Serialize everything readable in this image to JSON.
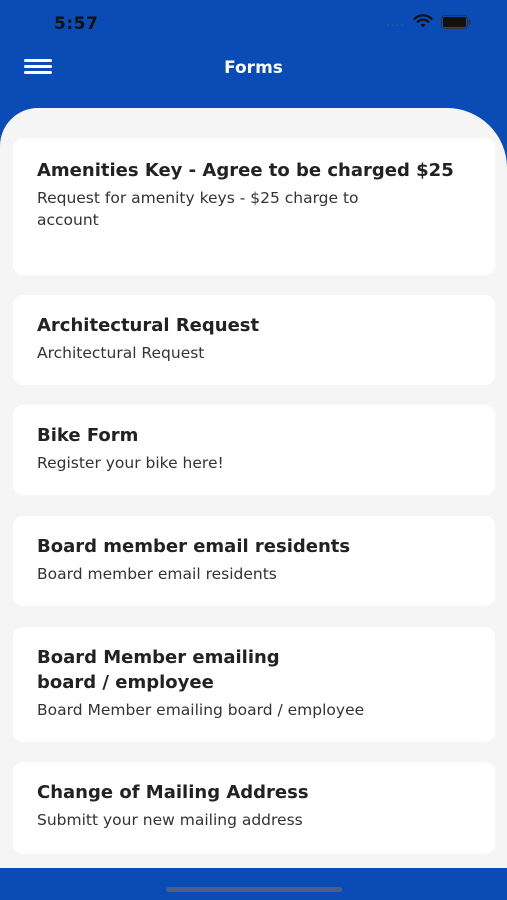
{
  "status": {
    "time": "5:57",
    "signal": "....",
    "wifi_icon": "wifi-icon",
    "battery_icon": "battery-icon"
  },
  "header": {
    "title": "Forms",
    "menu_icon": "hamburger-menu-icon"
  },
  "forms": [
    {
      "title": "Amenities Key - Agree to be charged $25",
      "description": "Request for amenity keys - $25 charge to account"
    },
    {
      "title": "Architectural Request",
      "description": "Architectural Request"
    },
    {
      "title": "Bike Form",
      "description": "Register your bike here!"
    },
    {
      "title": "Board member email residents",
      "description": "Board member email residents"
    },
    {
      "title": "Board Member emailing board / employee",
      "description": "Board Member emailing board / employee"
    },
    {
      "title": "Change of Mailing Address",
      "description": "Submitt your new mailing address"
    }
  ],
  "colors": {
    "brand": "#0a4bb5",
    "background": "#f5f5f6",
    "card": "#ffffff"
  }
}
